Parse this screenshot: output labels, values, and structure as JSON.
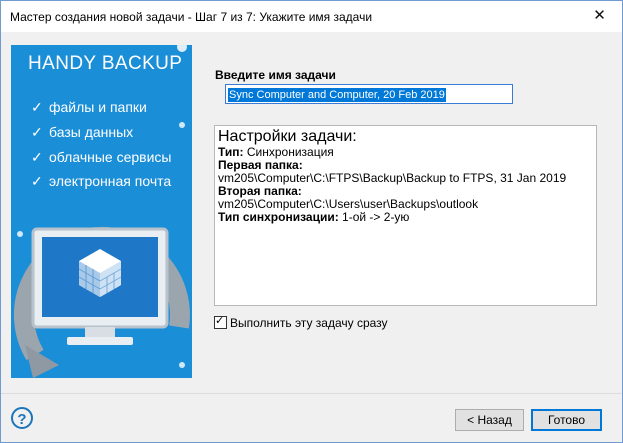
{
  "window": {
    "title": "Мастер создания новой задачи - Шаг 7 из 7: Укажите имя задачи",
    "close_glyph": "✕"
  },
  "banner": {
    "brand": "HANDY BACKUP",
    "features": [
      "файлы и папки",
      "базы данных",
      "облачные сервисы",
      "электронная почта"
    ],
    "check_glyph": "✓",
    "colors": {
      "background": "#1b8ed8",
      "accent": "#ffffff"
    }
  },
  "task_name": {
    "label": "Введите имя задачи",
    "value": "Sync Computer and Computer, 20 Feb 2019"
  },
  "settings": {
    "heading": "Настройки задачи:",
    "type_label": "Тип:",
    "type_value": "Синхронизация",
    "first_folder_label": "Первая папка:",
    "first_folder_value": "vm205\\Computer\\C:\\FTPS\\Backup\\Backup to FTPS, 31 Jan 2019",
    "second_folder_label": "Вторая папка:",
    "second_folder_value": "vm205\\Computer\\C:\\Users\\user\\Backups\\outlook",
    "sync_type_label": "Тип синхронизации:",
    "sync_type_value": "1-ой -> 2-ую"
  },
  "run_now": {
    "label": "Выполнить эту задачу сразу",
    "checked": true
  },
  "footer": {
    "help_glyph": "?",
    "back_label": "< Назад",
    "finish_label": "Готово"
  }
}
